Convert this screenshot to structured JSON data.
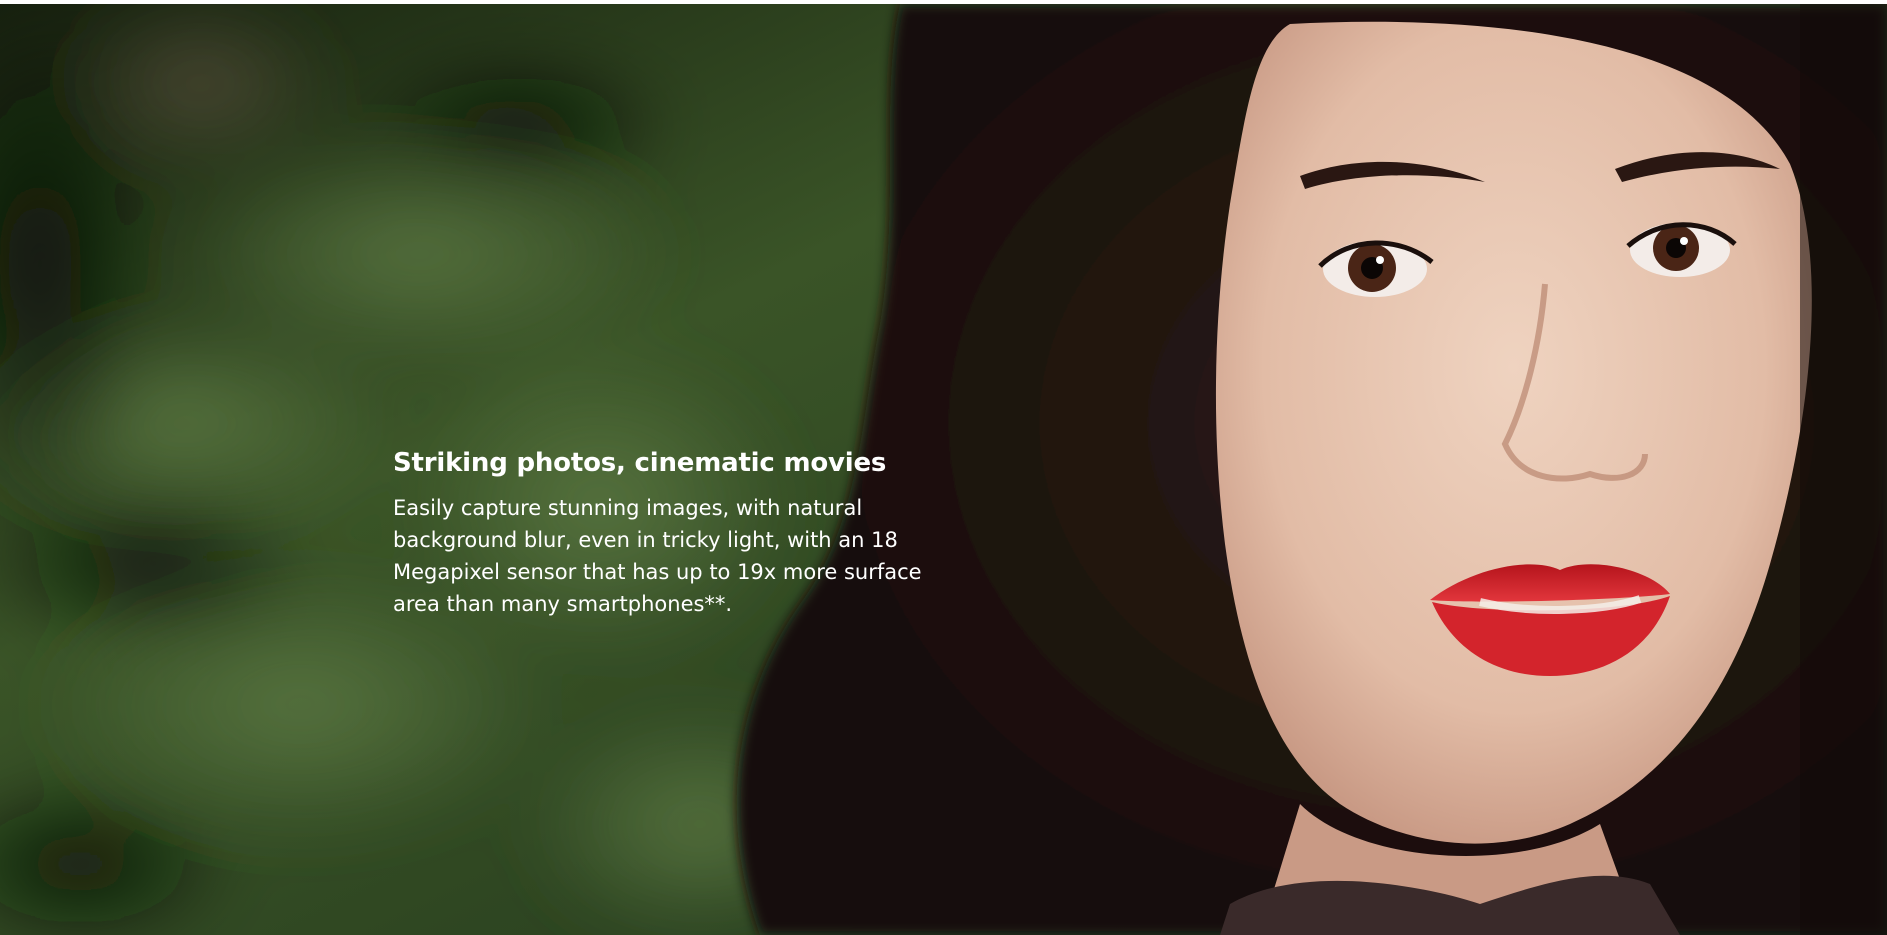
{
  "hero": {
    "headline": "Striking photos, cinematic movies",
    "body": "Easily capture stunning images, with natural background blur, even in tricky light, with an 18 Megapixel sensor that has up to 19x more surface area than many smartphones**."
  },
  "colors": {
    "top_strip": "#ffffff",
    "text": "#ffffff",
    "foliage_dark": "#1e2a17",
    "foliage_mid": "#3d5a2a",
    "hair": "#1f1310",
    "skin": "#e3c2ad",
    "lips": "#c21a22"
  },
  "icons": {
    "photo": "portrait-photo"
  }
}
